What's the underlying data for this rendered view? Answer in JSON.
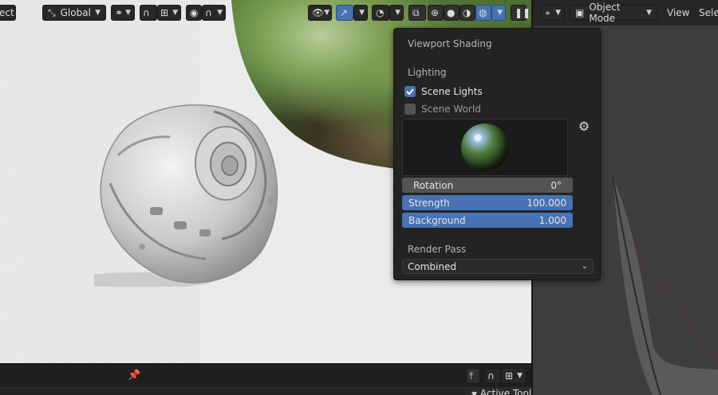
{
  "header_left": {
    "select_label_fragment": "ect",
    "transform_orientation": "Global"
  },
  "header_right": {
    "mode": "Object Mode",
    "view_label": "View",
    "select_fragment": "Selec"
  },
  "popover": {
    "title": "Viewport Shading",
    "lighting_label": "Lighting",
    "scene_lights_label": "Scene Lights",
    "scene_lights_checked": true,
    "scene_world_label": "Scene World",
    "scene_world_checked": false,
    "rotation_label": "Rotation",
    "rotation_value": "0°",
    "strength_label": "Strength",
    "strength_value": "100.000",
    "background_label": "Background",
    "background_value": "1.000",
    "render_pass_label": "Render Pass",
    "render_pass_value": "Combined"
  },
  "bottom": {
    "active_tool_label": "Active Tool"
  },
  "colors": {
    "accent": "#4772b3",
    "panel": "#232323",
    "header": "#262626"
  }
}
